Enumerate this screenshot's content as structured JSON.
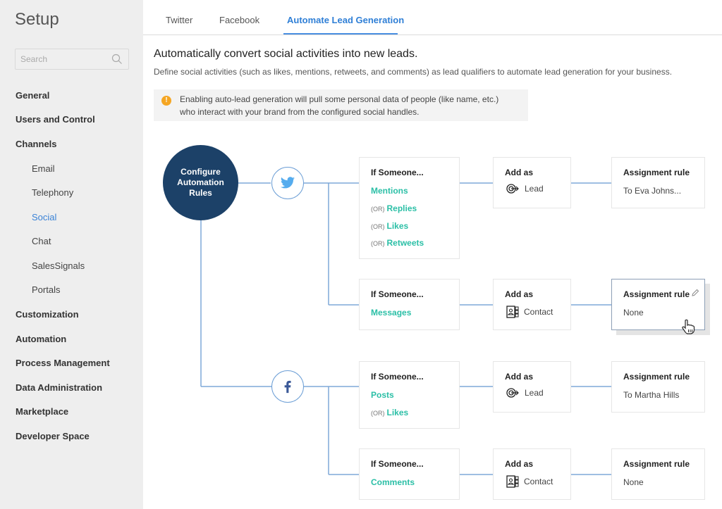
{
  "sidebar": {
    "title": "Setup",
    "search_placeholder": "Search",
    "items": [
      {
        "label": "General",
        "level": 0
      },
      {
        "label": "Users and Control",
        "level": 0
      },
      {
        "label": "Channels",
        "level": 0
      },
      {
        "label": "Email",
        "level": 1
      },
      {
        "label": "Telephony",
        "level": 1
      },
      {
        "label": "Social",
        "level": 1,
        "active": true
      },
      {
        "label": "Chat",
        "level": 1
      },
      {
        "label": "SalesSignals",
        "level": 1
      },
      {
        "label": "Portals",
        "level": 1
      },
      {
        "label": "Customization",
        "level": 0
      },
      {
        "label": "Automation",
        "level": 0
      },
      {
        "label": "Process Management",
        "level": 0
      },
      {
        "label": "Data Administration",
        "level": 0
      },
      {
        "label": "Marketplace",
        "level": 0
      },
      {
        "label": "Developer Space",
        "level": 0
      }
    ]
  },
  "tabs": [
    {
      "label": "Twitter"
    },
    {
      "label": "Facebook"
    },
    {
      "label": "Automate Lead Generation",
      "active": true
    }
  ],
  "main": {
    "heading": "Automatically convert social activities into new leads.",
    "subheading": "Define social activities (such as likes, mentions, retweets, and comments) as lead qualifiers to automate lead generation for your business.",
    "notice_line1": "Enabling auto-lead generation will pull some personal data of people (like name, etc.)",
    "notice_line2": "who interact with your brand from the configured social handles.",
    "notice_icon": "warning-icon"
  },
  "flow": {
    "hub_line1": "Configure",
    "hub_line2": "Automation",
    "hub_line3": "Rules",
    "or_label": "(OR)",
    "condition_title": "If Someone...",
    "add_title": "Add as",
    "assign_title": "Assignment rule",
    "rules": [
      {
        "network": "twitter",
        "actions": [
          "Mentions",
          "Replies",
          "Likes",
          "Retweets"
        ],
        "add_as": "Lead",
        "add_icon": "lead-target-icon",
        "assignment": "To Eva Johns..."
      },
      {
        "network": "twitter",
        "actions": [
          "Messages"
        ],
        "add_as": "Contact",
        "add_icon": "contact-card-icon",
        "assignment": "None",
        "selected": true
      },
      {
        "network": "facebook",
        "actions": [
          "Posts",
          "Likes"
        ],
        "add_as": "Lead",
        "add_icon": "lead-target-icon",
        "assignment": "To Martha Hills"
      },
      {
        "network": "facebook",
        "actions": [
          "Comments"
        ],
        "add_as": "Contact",
        "add_icon": "contact-card-icon",
        "assignment": "None"
      }
    ]
  },
  "colors": {
    "accent": "#2f7fd6",
    "hub": "#1c4168",
    "action_teal": "#2bbfa6",
    "connector": "#7fa9d8",
    "warning": "#f5a623",
    "twitter": "#55acee",
    "facebook": "#3b5998"
  }
}
